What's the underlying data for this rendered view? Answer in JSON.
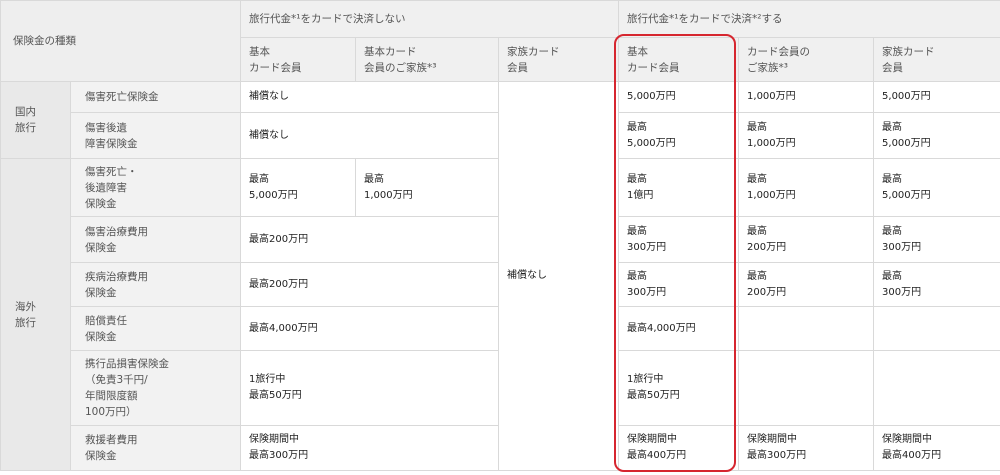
{
  "header": {
    "type_label": "保険金の種類",
    "group_no_pay": "旅行代金*¹をカードで決済しない",
    "group_pay": "旅行代金*¹をカードで決済*²する",
    "cols": {
      "np_basic": "基本\nカード会員",
      "np_basic_family": "基本カード\n会員のご家族*³",
      "np_family": "家族カード\n会員",
      "p_basic": "基本\nカード会員",
      "p_member_family": "カード会員の\nご家族*³",
      "p_family": "家族カード\n会員"
    }
  },
  "categories": {
    "domestic": "国内\n旅行",
    "overseas": "海外\n旅行"
  },
  "rows": [
    {
      "item": "傷害死亡保険金",
      "np_basic": "補償なし",
      "p_basic": "5,000万円",
      "p_member_family": "1,000万円",
      "p_family": "5,000万円"
    },
    {
      "item": "傷害後遺\n障害保険金",
      "np_basic": "補償なし",
      "p_basic": "最高\n5,000万円",
      "p_member_family": "最高\n1,000万円",
      "p_family": "最高\n5,000万円"
    },
    {
      "item": "傷害死亡・\n後遺障害\n保険金",
      "np_basic": "最高\n5,000万円",
      "np_basic_family": "最高\n1,000万円",
      "p_basic": "最高\n1億円",
      "p_member_family": "最高\n1,000万円",
      "p_family": "最高\n5,000万円"
    },
    {
      "item": "傷害治療費用\n保険金",
      "np_basic": "最高200万円",
      "p_basic": "最高\n300万円",
      "p_member_family": "最高\n200万円",
      "p_family": "最高\n300万円"
    },
    {
      "item": "疾病治療費用\n保険金",
      "np_basic": "最高200万円",
      "p_basic": "最高\n300万円",
      "p_member_family": "最高\n200万円",
      "p_family": "最高\n300万円"
    },
    {
      "item": "賠償責任\n保険金",
      "np_basic": "最高4,000万円",
      "p_basic": "最高4,000万円"
    },
    {
      "item": "携行品損害保険金\n（免責3千円/\n年間限度額\n100万円）",
      "np_basic": "1旅行中\n最高50万円",
      "p_basic": "1旅行中\n最高50万円"
    },
    {
      "item": "救援者費用\n保険金",
      "np_basic": "保険期間中\n最高300万円",
      "p_basic": "保険期間中\n最高400万円",
      "p_member_family": "保険期間中\n最高300万円",
      "p_family": "保険期間中\n最高400万円"
    }
  ],
  "family_card_no_pay": "補償なし",
  "colors": {
    "highlight": "#d6262f",
    "header_bg": "#f0f0f0",
    "border": "#d9d9d9"
  }
}
